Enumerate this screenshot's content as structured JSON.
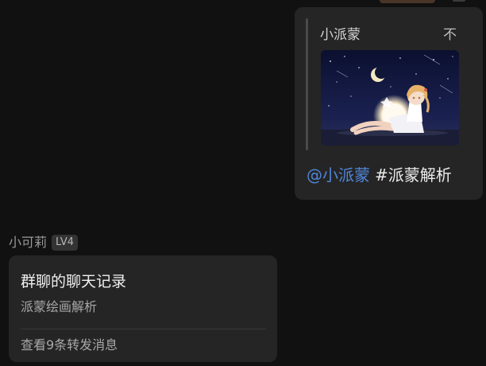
{
  "colors": {
    "background": "#111111",
    "bubble": "#252525",
    "mention": "#4f86d9"
  },
  "quoted_message": {
    "sender": "小派蒙",
    "trailing_text": "不",
    "image_icon": "anime-girl-moon-illustration"
  },
  "reply_message": {
    "mention": "@小派蒙",
    "hashtag": "#派蒙解析"
  },
  "sender": {
    "name": "小可莉",
    "level": "LV4"
  },
  "forward_card": {
    "title": "群聊的聊天记录",
    "preview": "派蒙绘画解析",
    "footer": "查看9条转发消息"
  }
}
